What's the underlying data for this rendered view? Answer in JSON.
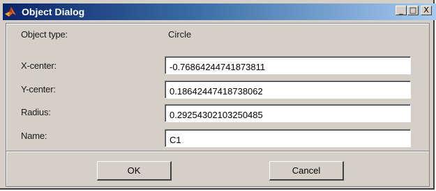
{
  "window": {
    "title": "Object Dialog",
    "controls": {
      "minimize": "_",
      "restore": "□",
      "close": "X"
    }
  },
  "form": {
    "object_type": {
      "label": "Object type:",
      "value": "Circle"
    },
    "x_center": {
      "label": "X-center:",
      "value": "-0.76864244741873811"
    },
    "y_center": {
      "label": "Y-center:",
      "value": "0.18642447418738062"
    },
    "radius": {
      "label": "Radius:",
      "value": "0.29254302103250485"
    },
    "name": {
      "label": "Name:",
      "value": "C1"
    }
  },
  "buttons": {
    "ok": "OK",
    "cancel": "Cancel"
  },
  "colors": {
    "titlebar_start": "#0a246a",
    "titlebar_end": "#a6caf0",
    "dialog_face": "#d4d0c8"
  },
  "icons": {
    "app": "matlab-logo-icon"
  }
}
